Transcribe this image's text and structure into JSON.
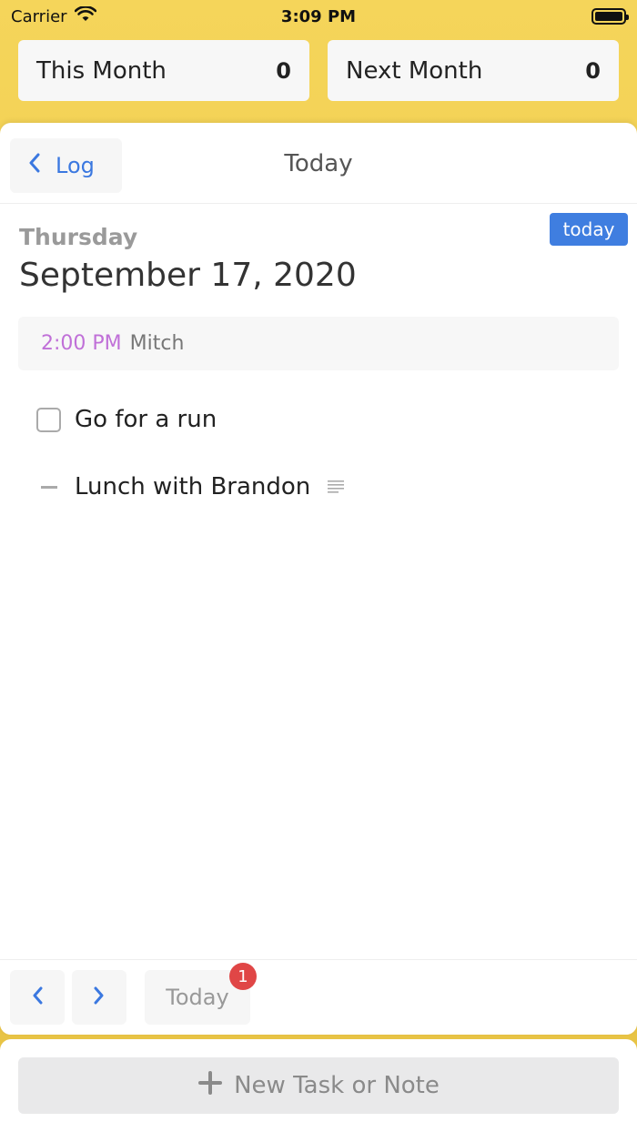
{
  "status_bar": {
    "carrier": "Carrier",
    "time": "3:09 PM"
  },
  "summary": {
    "this_month": {
      "label": "This Month",
      "count": "0"
    },
    "next_month": {
      "label": "Next Month",
      "count": "0"
    }
  },
  "header": {
    "back_label": "Log",
    "title": "Today"
  },
  "day": {
    "badge": "today",
    "weekday": "Thursday",
    "date": "September 17, 2020"
  },
  "event": {
    "time": "2:00 PM",
    "title": "Mitch"
  },
  "items": [
    {
      "type": "task",
      "label": "Go for a run"
    },
    {
      "type": "note",
      "label": "Lunch with Brandon"
    }
  ],
  "footer": {
    "today_label": "Today",
    "badge_count": "1"
  },
  "composer": {
    "label": "New Task or Note"
  },
  "colors": {
    "accent": "#3f7ee0",
    "background": "#f5d55a",
    "event_time": "#c070d8",
    "badge": "#e04646"
  }
}
